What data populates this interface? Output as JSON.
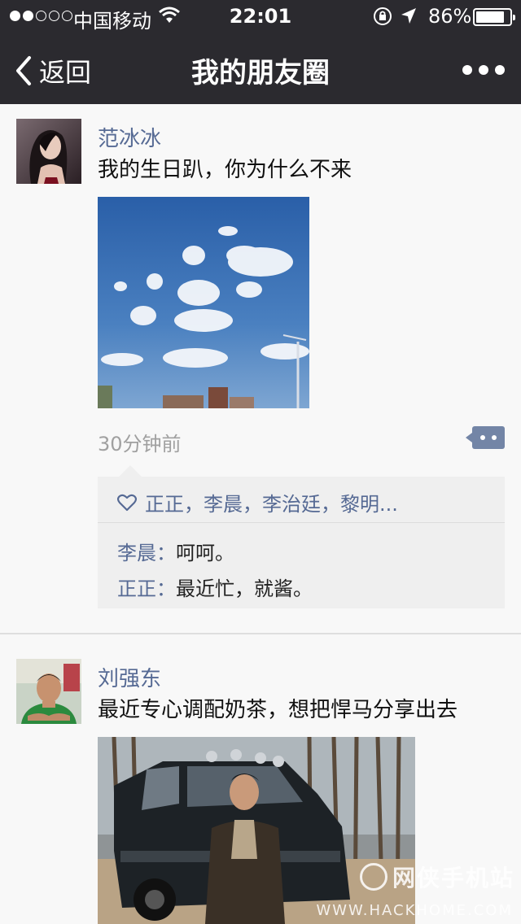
{
  "status_bar": {
    "carrier": "中国移动",
    "time": "22:01",
    "battery_percent": "86%",
    "battery_level": 0.86,
    "signal_bars_filled": 2,
    "signal_bars_total": 5
  },
  "nav": {
    "back_label": "返回",
    "title": "我的朋友圈",
    "more_icon": "more-icon"
  },
  "posts": [
    {
      "name": "范冰冰",
      "text": "我的生日趴，你为什么不来",
      "time_ago": "30分钟前",
      "likes": "正正，李晨，李治廷，黎明...",
      "comments": [
        {
          "name": "李晨：",
          "text": "呵呵。"
        },
        {
          "name": "正正：",
          "text": "最近忙，就酱。"
        }
      ]
    },
    {
      "name": "刘强东",
      "text": "最近专心调配奶茶，想把悍马分享出去"
    }
  ],
  "watermark": {
    "brand": "网侠手机站",
    "url": "WWW.HACKHOME.COM"
  },
  "colors": {
    "nav_bg": "#2b2a2f",
    "name_color": "#566a94",
    "feed_bg": "#f8f8f8",
    "comment_bg": "#efefef"
  }
}
